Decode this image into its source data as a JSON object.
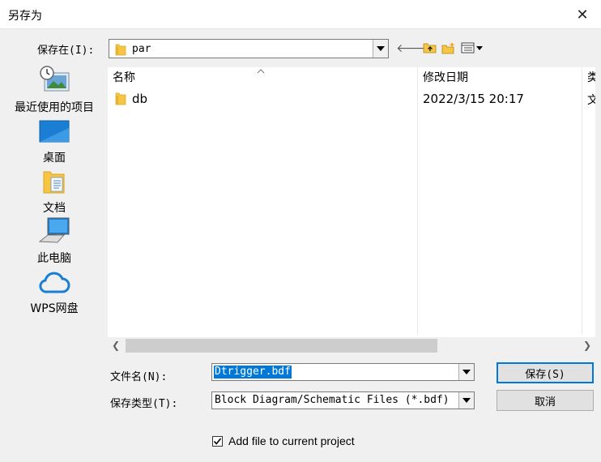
{
  "window": {
    "title": "另存为",
    "close_glyph": "✕"
  },
  "lookin": {
    "label": "保存在(I):",
    "value": "par"
  },
  "toolbar": {
    "back_glyph": "🡐",
    "up_folder_icon": "up-folder-icon",
    "new_folder_icon": "new-folder-icon",
    "view_menu_icon": "view-menu-icon"
  },
  "places": [
    {
      "label": "最近使用的项目",
      "icon": "recent-items-icon"
    },
    {
      "label": "桌面",
      "icon": "desktop-icon"
    },
    {
      "label": "文档",
      "icon": "documents-icon"
    },
    {
      "label": "此电脑",
      "icon": "computer-icon"
    },
    {
      "label": "WPS网盘",
      "icon": "cloud-icon"
    }
  ],
  "list": {
    "columns": [
      "名称",
      "修改日期",
      "类"
    ],
    "rows": [
      {
        "name": "db",
        "date": "2022/3/15 20:17",
        "type": "文"
      }
    ]
  },
  "filename": {
    "label": "文件名(N):",
    "value": "Dtrigger.bdf"
  },
  "filetype": {
    "label": "保存类型(T):",
    "value": "Block Diagram/Schematic Files (*.bdf)"
  },
  "buttons": {
    "save": "保存(S)",
    "cancel": "取消"
  },
  "add_to_project": {
    "label": "Add file to current project",
    "checked": true
  },
  "colors": {
    "selection": "#0078d7",
    "folder": "#f5c543",
    "accent_blue": "#1a7fd4"
  }
}
